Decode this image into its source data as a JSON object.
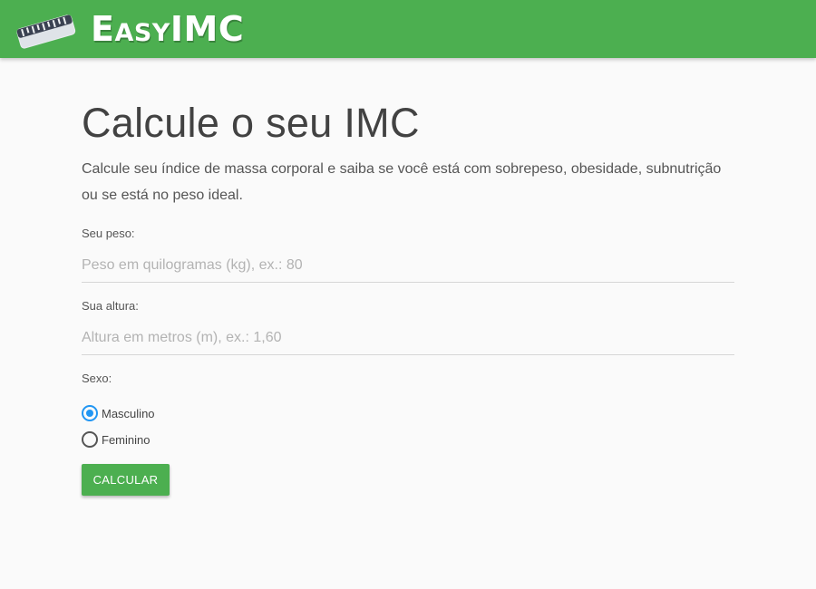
{
  "header": {
    "brand_first": "E",
    "brand_small": "asy",
    "brand_rest": "IMC",
    "logo_icon": "ruler-icon",
    "background_color": "#4caf50"
  },
  "main": {
    "title": "Calcule o seu IMC",
    "description": "Calcule seu índice de massa corporal e saiba se você está com sobrepeso, obesidade, subnutrição ou se está no peso ideal.",
    "weight": {
      "label": "Seu peso:",
      "placeholder": "Peso em quilogramas (kg), ex.: 80",
      "value": ""
    },
    "height": {
      "label": "Sua altura:",
      "placeholder": "Altura em metros (m), ex.: 1,60",
      "value": ""
    },
    "sex": {
      "label": "Sexo:",
      "options": [
        {
          "label": "Masculino",
          "checked": true
        },
        {
          "label": "Feminino",
          "checked": false
        }
      ],
      "accent_color": "#2196f3"
    },
    "submit_label": "CALCULAR"
  }
}
